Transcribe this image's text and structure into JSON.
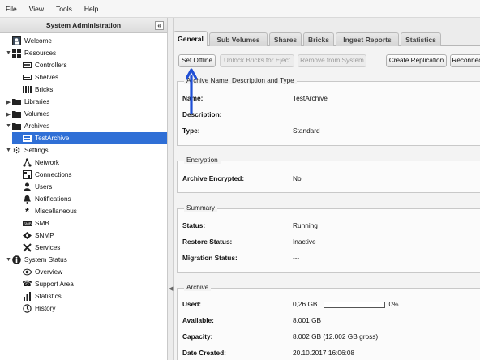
{
  "menubar": {
    "items": [
      "File",
      "View",
      "Tools",
      "Help"
    ]
  },
  "sidebar": {
    "title": "System Administration",
    "collapse": "«",
    "nodes": [
      {
        "label": "Welcome",
        "icon": "welcome-icon"
      },
      {
        "label": "Resources",
        "icon": "grid-icon"
      },
      {
        "label": "Controllers",
        "icon": "controller-icon"
      },
      {
        "label": "Shelves",
        "icon": "shelf-icon"
      },
      {
        "label": "Bricks",
        "icon": "brick-icon"
      },
      {
        "label": "Libraries",
        "icon": "folder-icon"
      },
      {
        "label": "Volumes",
        "icon": "folder-icon"
      },
      {
        "label": "Archives",
        "icon": "folder-icon"
      },
      {
        "label": "TestArchive",
        "icon": "archive-icon"
      },
      {
        "label": "Settings",
        "icon": "gear-icon"
      },
      {
        "label": "Network",
        "icon": "network-icon"
      },
      {
        "label": "Connections",
        "icon": "connections-icon"
      },
      {
        "label": "Users",
        "icon": "user-icon"
      },
      {
        "label": "Notifications",
        "icon": "bell-icon"
      },
      {
        "label": "Miscellaneous",
        "icon": "asterisk-icon"
      },
      {
        "label": "SMB",
        "icon": "smb-icon"
      },
      {
        "label": "SNMP",
        "icon": "snmp-icon"
      },
      {
        "label": "Services",
        "icon": "tools-icon"
      },
      {
        "label": "System Status",
        "icon": "info-icon"
      },
      {
        "label": "Overview",
        "icon": "eye-icon"
      },
      {
        "label": "Support Area",
        "icon": "phone-icon"
      },
      {
        "label": "Statistics",
        "icon": "chart-icon"
      },
      {
        "label": "History",
        "icon": "history-icon"
      }
    ]
  },
  "tabs": [
    "General",
    "Sub Volumes",
    "Shares",
    "Bricks",
    "Ingest Reports",
    "Statistics"
  ],
  "toolbar": {
    "set_offline": "Set Offline",
    "unlock_bricks": "Unlock Bricks for Eject",
    "remove_system": "Remove from System",
    "create_replication": "Create Replication",
    "reconnect": "Reconnect"
  },
  "archive_info": {
    "title": "Archive Name, Description and Type",
    "name_label": "Name:",
    "name": "TestArchive",
    "description_label": "Description:",
    "description": "",
    "type_label": "Type:",
    "type": "Standard"
  },
  "encryption": {
    "title": "Encryption",
    "label": "Archive Encrypted:",
    "value": "No"
  },
  "summary": {
    "title": "Summary",
    "status_label": "Status:",
    "status": "Running",
    "restore_label": "Restore Status:",
    "restore": "Inactive",
    "migration_label": "Migration Status:",
    "migration": "---"
  },
  "archive": {
    "title": "Archive",
    "used_label": "Used:",
    "used": "0,26 GB",
    "used_pct": "0%",
    "used_fraction": 0,
    "available_label": "Available:",
    "available": "8.001 GB",
    "capacity_label": "Capacity:",
    "capacity": "8.002 GB (12.002 GB gross)",
    "created_label": "Date Created:",
    "created": "20.10.2017 16:06:08"
  },
  "colors": {
    "selection": "#2f6fd6",
    "annotation": "#1f4fd6"
  }
}
